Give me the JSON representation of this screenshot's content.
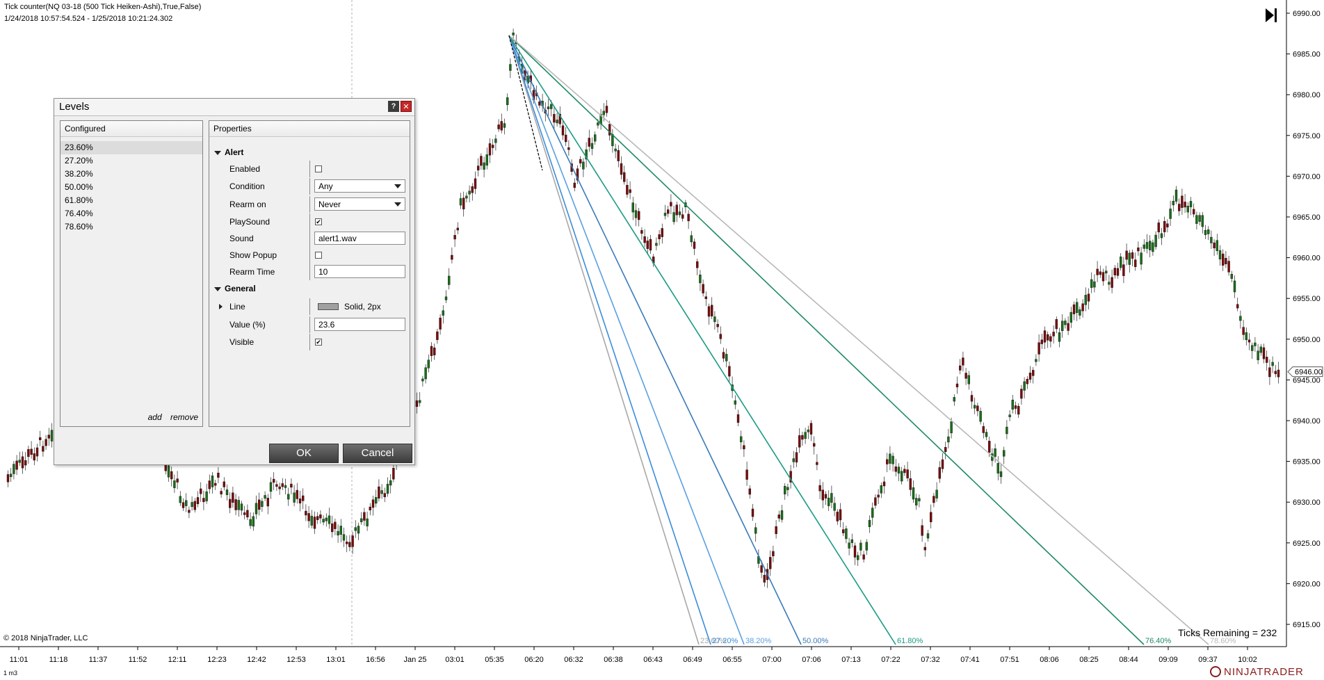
{
  "chart": {
    "title": "Tick counter(NQ 03-18 (500 Tick Heiken-Ashi),True,False)",
    "date_range": "1/24/2018 10:57:54.524 - 1/25/2018 10:21:24.302",
    "copyright": "© 2018 NinjaTrader, LLC",
    "ticks_remaining": "Ticks Remaining = 232",
    "bottom_tag": "1 m3",
    "brand": "NINJATRADER",
    "current_price": "6946.00",
    "y_labels": [
      "6990.00",
      "6985.00",
      "6980.00",
      "6975.00",
      "6970.00",
      "6965.00",
      "6960.00",
      "6955.00",
      "6950.00",
      "6945.00",
      "6940.00",
      "6935.00",
      "6930.00",
      "6925.00",
      "6920.00",
      "6915.00"
    ],
    "x_labels": [
      "11:01",
      "11:18",
      "11:37",
      "11:52",
      "12:11",
      "12:23",
      "12:42",
      "12:53",
      "13:01",
      "16:56",
      "Jan 25",
      "03:01",
      "05:35",
      "06:20",
      "06:32",
      "06:38",
      "06:43",
      "06:49",
      "06:55",
      "07:00",
      "07:06",
      "07:13",
      "07:22",
      "07:32",
      "07:41",
      "07:51",
      "08:06",
      "08:25",
      "08:44",
      "09:09",
      "09:37",
      "10:02"
    ],
    "fib_labels": [
      {
        "text": "23.60%",
        "color": "#a8a8a8"
      },
      {
        "text": "27.20%",
        "color": "#3c8cd8"
      },
      {
        "text": "38.20%",
        "color": "#5aa0e0"
      },
      {
        "text": "50.00%",
        "color": "#3a7ab8"
      },
      {
        "text": "61.80%",
        "color": "#1a9a84"
      },
      {
        "text": "76.40%",
        "color": "#1e8a60"
      },
      {
        "text": "78.60%",
        "color": "#b8b8b8"
      }
    ],
    "colors": {
      "up": "#1a6e1a",
      "down": "#7a0a0a",
      "axis": "#000000"
    },
    "icons": [
      "play-end-icon",
      "ninjatrader-logo-icon"
    ]
  },
  "dialog": {
    "title": "Levels",
    "help": "?",
    "close": "✕",
    "configured_header": "Configured",
    "levels": [
      "23.60%",
      "27.20%",
      "38.20%",
      "50.00%",
      "61.80%",
      "76.40%",
      "78.60%"
    ],
    "add": "add",
    "remove": "remove",
    "properties_header": "Properties",
    "alert_section": "Alert",
    "enabled_label": "Enabled",
    "condition_label": "Condition",
    "condition_value": "Any",
    "rearm_on_label": "Rearm on",
    "rearm_on_value": "Never",
    "playsound_label": "PlaySound",
    "playsound_check": "✔",
    "sound_label": "Sound",
    "sound_value": "alert1.wav",
    "show_popup_label": "Show Popup",
    "rearm_time_label": "Rearm Time",
    "rearm_time_value": "10",
    "general_section": "General",
    "line_label": "Line",
    "line_value": "Solid, 2px",
    "value_label": "Value (%)",
    "value_value": "23.6",
    "visible_label": "Visible",
    "visible_check": "✔",
    "ok": "OK",
    "cancel": "Cancel"
  }
}
